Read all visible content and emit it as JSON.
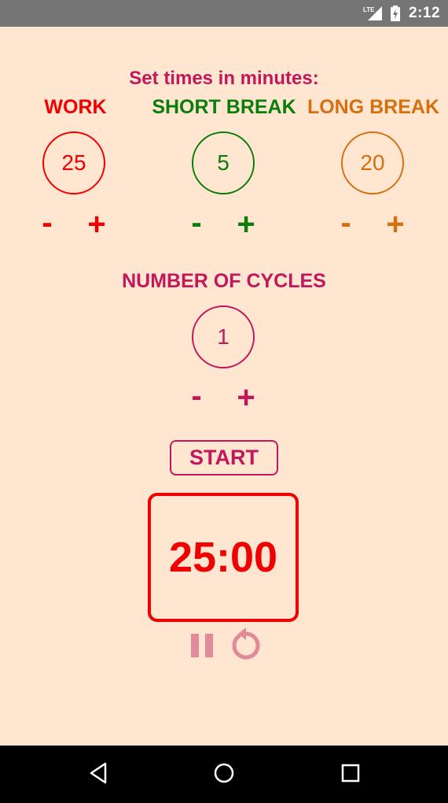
{
  "status_bar": {
    "network_icon": "lte-signal-icon",
    "network_label": "LTE",
    "battery_icon": "battery-charging-icon",
    "time": "2:12"
  },
  "heading": "Set times in minutes:",
  "timers": {
    "work": {
      "label": "WORK",
      "value": "25",
      "minus": "-",
      "plus": "+",
      "color": "#f00000"
    },
    "short_break": {
      "label": "SHORT BREAK",
      "value": "5",
      "minus": "-",
      "plus": "+",
      "color": "#0a7d0a"
    },
    "long_break": {
      "label": "LONG BREAK",
      "value": "20",
      "minus": "-",
      "plus": "+",
      "color": "#d4700f"
    }
  },
  "cycles": {
    "label": "NUMBER OF CYCLES",
    "value": "1",
    "minus": "-",
    "plus": "+",
    "color": "#c2185b"
  },
  "start_label": "START",
  "countdown": {
    "time": "25:00",
    "color": "#f00000"
  },
  "controls": {
    "pause_icon": "pause-icon",
    "reset_icon": "reset-icon",
    "color": "#e08a9a"
  },
  "nav": {
    "back_icon": "back-icon",
    "home_icon": "home-icon",
    "recents_icon": "recents-icon"
  },
  "colors": {
    "background": "#ffe6d1",
    "accent": "#c2185b"
  }
}
